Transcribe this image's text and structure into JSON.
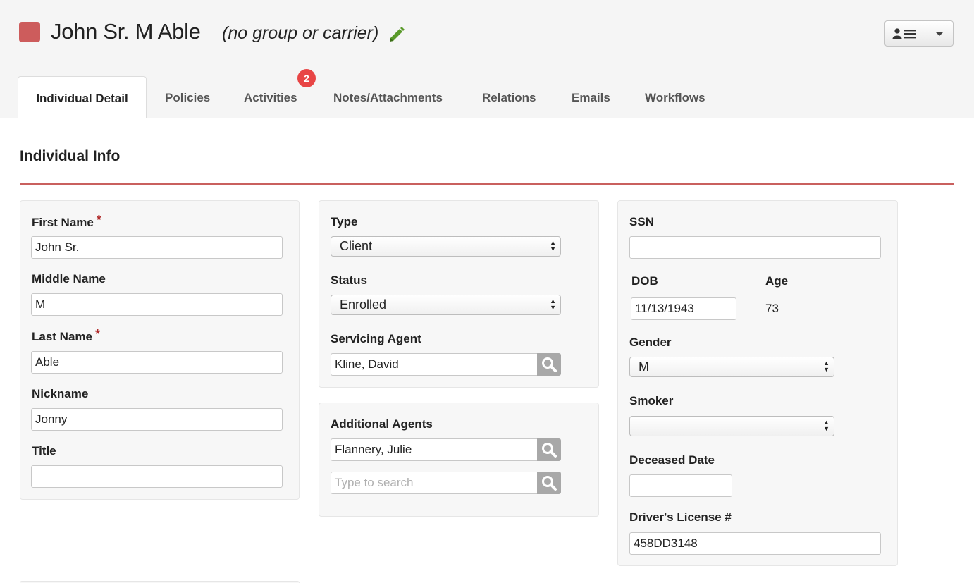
{
  "header": {
    "name": "John Sr. M Able",
    "group": "(no group or carrier)",
    "status_color": "#cd5c5c"
  },
  "tabs": [
    {
      "label": "Individual Detail",
      "active": true
    },
    {
      "label": "Policies"
    },
    {
      "label": "Activities",
      "badge": "2"
    },
    {
      "label": "Notes/Attachments"
    },
    {
      "label": "Relations"
    },
    {
      "label": "Emails"
    },
    {
      "label": "Workflows"
    }
  ],
  "section": {
    "title": "Individual Info",
    "accent": "#c9605e"
  },
  "name_panel": {
    "first_name": {
      "label": "First Name",
      "required": "*",
      "value": "John Sr."
    },
    "middle_name": {
      "label": "Middle Name",
      "value": "M"
    },
    "last_name": {
      "label": "Last Name",
      "required": "*",
      "value": "Able"
    },
    "nickname": {
      "label": "Nickname",
      "value": "Jonny"
    },
    "title": {
      "label": "Title",
      "value": ""
    }
  },
  "type_panel": {
    "type": {
      "label": "Type",
      "value": "Client"
    },
    "status": {
      "label": "Status",
      "value": "Enrolled"
    },
    "servicing_agent": {
      "label": "Servicing Agent",
      "value": "Kline, David"
    }
  },
  "agents_panel": {
    "label": "Additional Agents",
    "agent_1": "Flannery, Julie",
    "search_placeholder": "Type to search"
  },
  "details_panel": {
    "ssn": {
      "label": "SSN",
      "value": ""
    },
    "dob": {
      "label": "DOB",
      "value": "11/13/1943"
    },
    "age": {
      "label": "Age",
      "value": "73"
    },
    "gender": {
      "label": "Gender",
      "value": "M"
    },
    "smoker": {
      "label": "Smoker",
      "value": ""
    },
    "deceased_date": {
      "label": "Deceased Date",
      "value": ""
    },
    "drivers_license": {
      "label": "Driver's License #",
      "value": "458DD3148"
    }
  },
  "icons": {
    "edit": "pencil-icon",
    "user_menu": "user-list-icon",
    "dropdown": "caret-down-icon",
    "search": "magnifier-icon"
  }
}
